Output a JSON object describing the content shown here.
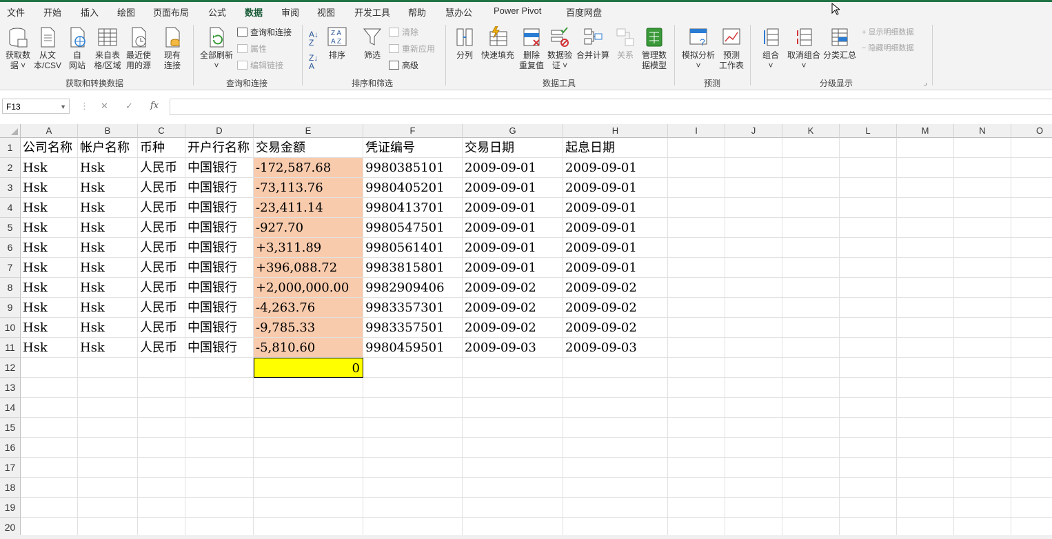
{
  "menu": {
    "tabs": [
      "文件",
      "开始",
      "插入",
      "绘图",
      "页面布局",
      "公式",
      "数据",
      "审阅",
      "视图",
      "开发工具",
      "帮助",
      "慧办公",
      "Power Pivot",
      "百度网盘"
    ],
    "active_tab": "数据"
  },
  "ribbon": {
    "get_transform": {
      "label": "获取和转换数据",
      "get_data": "获取数\n据 ˅",
      "from_text": "从文\n本/CSV",
      "from_web": "自\n网站",
      "from_table": "来自表\n格/区域",
      "recent_sources": "最近使\n用的源",
      "existing_conn": "现有\n连接"
    },
    "queries": {
      "label": "查询和连接",
      "refresh_all": "全部刷新\n˅",
      "queries_conn": "查询和连接",
      "properties": "属性",
      "edit_links": "编辑链接"
    },
    "sort_filter": {
      "label": "排序和筛选",
      "sort": "排序",
      "filter": "筛选",
      "clear": "清除",
      "reapply": "重新应用",
      "advanced": "高级"
    },
    "data_tools": {
      "label": "数据工具",
      "text_to_cols": "分列",
      "flash_fill": "快速填充",
      "remove_dup": "删除\n重复值",
      "validation": "数据验\n证 ˅",
      "consolidate": "合并计算",
      "relationships": "关系",
      "data_model": "管理数\n据模型"
    },
    "forecast": {
      "label": "预测",
      "what_if": "模拟分析\n˅",
      "forecast_sheet": "预测\n工作表"
    },
    "outline": {
      "label": "分级显示",
      "group": "组合\n˅",
      "ungroup": "取消组合\n˅",
      "subtotal": "分类汇总",
      "show_detail": "显示明细数据",
      "hide_detail": "隐藏明细数据"
    }
  },
  "formula_bar": {
    "name_box": "F13",
    "fx": "fx",
    "cancel": "✕",
    "enter": "✓",
    "value": ""
  },
  "sheet": {
    "columns": [
      "A",
      "B",
      "C",
      "D",
      "E",
      "F",
      "G",
      "H",
      "I",
      "J",
      "K",
      "L",
      "M",
      "N",
      "O"
    ],
    "row_numbers": [
      "1",
      "2",
      "3",
      "4",
      "5",
      "6",
      "7",
      "8",
      "9",
      "10",
      "11",
      "12",
      "13",
      "14",
      "15",
      "16",
      "17",
      "18",
      "19",
      "20"
    ],
    "header_row": [
      "公司名称",
      "帐户名称",
      "币种",
      "开户行名称",
      "交易金额",
      "凭证编号",
      "交易日期",
      "起息日期"
    ],
    "rows": [
      [
        "Hsk",
        "Hsk",
        "人民币",
        "中国银行",
        "-172,587.68",
        "9980385101",
        "2009-09-01",
        "2009-09-01"
      ],
      [
        "Hsk",
        "Hsk",
        "人民币",
        "中国银行",
        "-73,113.76",
        "9980405201",
        "2009-09-01",
        "2009-09-01"
      ],
      [
        "Hsk",
        "Hsk",
        "人民币",
        "中国银行",
        "-23,411.14",
        "9980413701",
        "2009-09-01",
        "2009-09-01"
      ],
      [
        "Hsk",
        "Hsk",
        "人民币",
        "中国银行",
        "-927.70",
        "9980547501",
        "2009-09-01",
        "2009-09-01"
      ],
      [
        "Hsk",
        "Hsk",
        "人民币",
        "中国银行",
        "+3,311.89",
        "9980561401",
        "2009-09-01",
        "2009-09-01"
      ],
      [
        "Hsk",
        "Hsk",
        "人民币",
        "中国银行",
        "+396,088.72",
        "9983815801",
        "2009-09-01",
        "2009-09-01"
      ],
      [
        "Hsk",
        "Hsk",
        "人民币",
        "中国银行",
        "+2,000,000.00",
        "9982909406",
        "2009-09-02",
        "2009-09-02"
      ],
      [
        "Hsk",
        "Hsk",
        "人民币",
        "中国银行",
        "-4,263.76",
        "9983357301",
        "2009-09-02",
        "2009-09-02"
      ],
      [
        "Hsk",
        "Hsk",
        "人民币",
        "中国银行",
        "-9,785.33",
        "9983357501",
        "2009-09-02",
        "2009-09-02"
      ],
      [
        "Hsk",
        "Hsk",
        "人民币",
        "中国银行",
        "-5,810.60",
        "9980459501",
        "2009-09-03",
        "2009-09-03"
      ]
    ],
    "sum_cell": "0",
    "colors": {
      "highlight": "#f8cbad",
      "sum": "#ffff00",
      "accent": "#217346"
    }
  }
}
